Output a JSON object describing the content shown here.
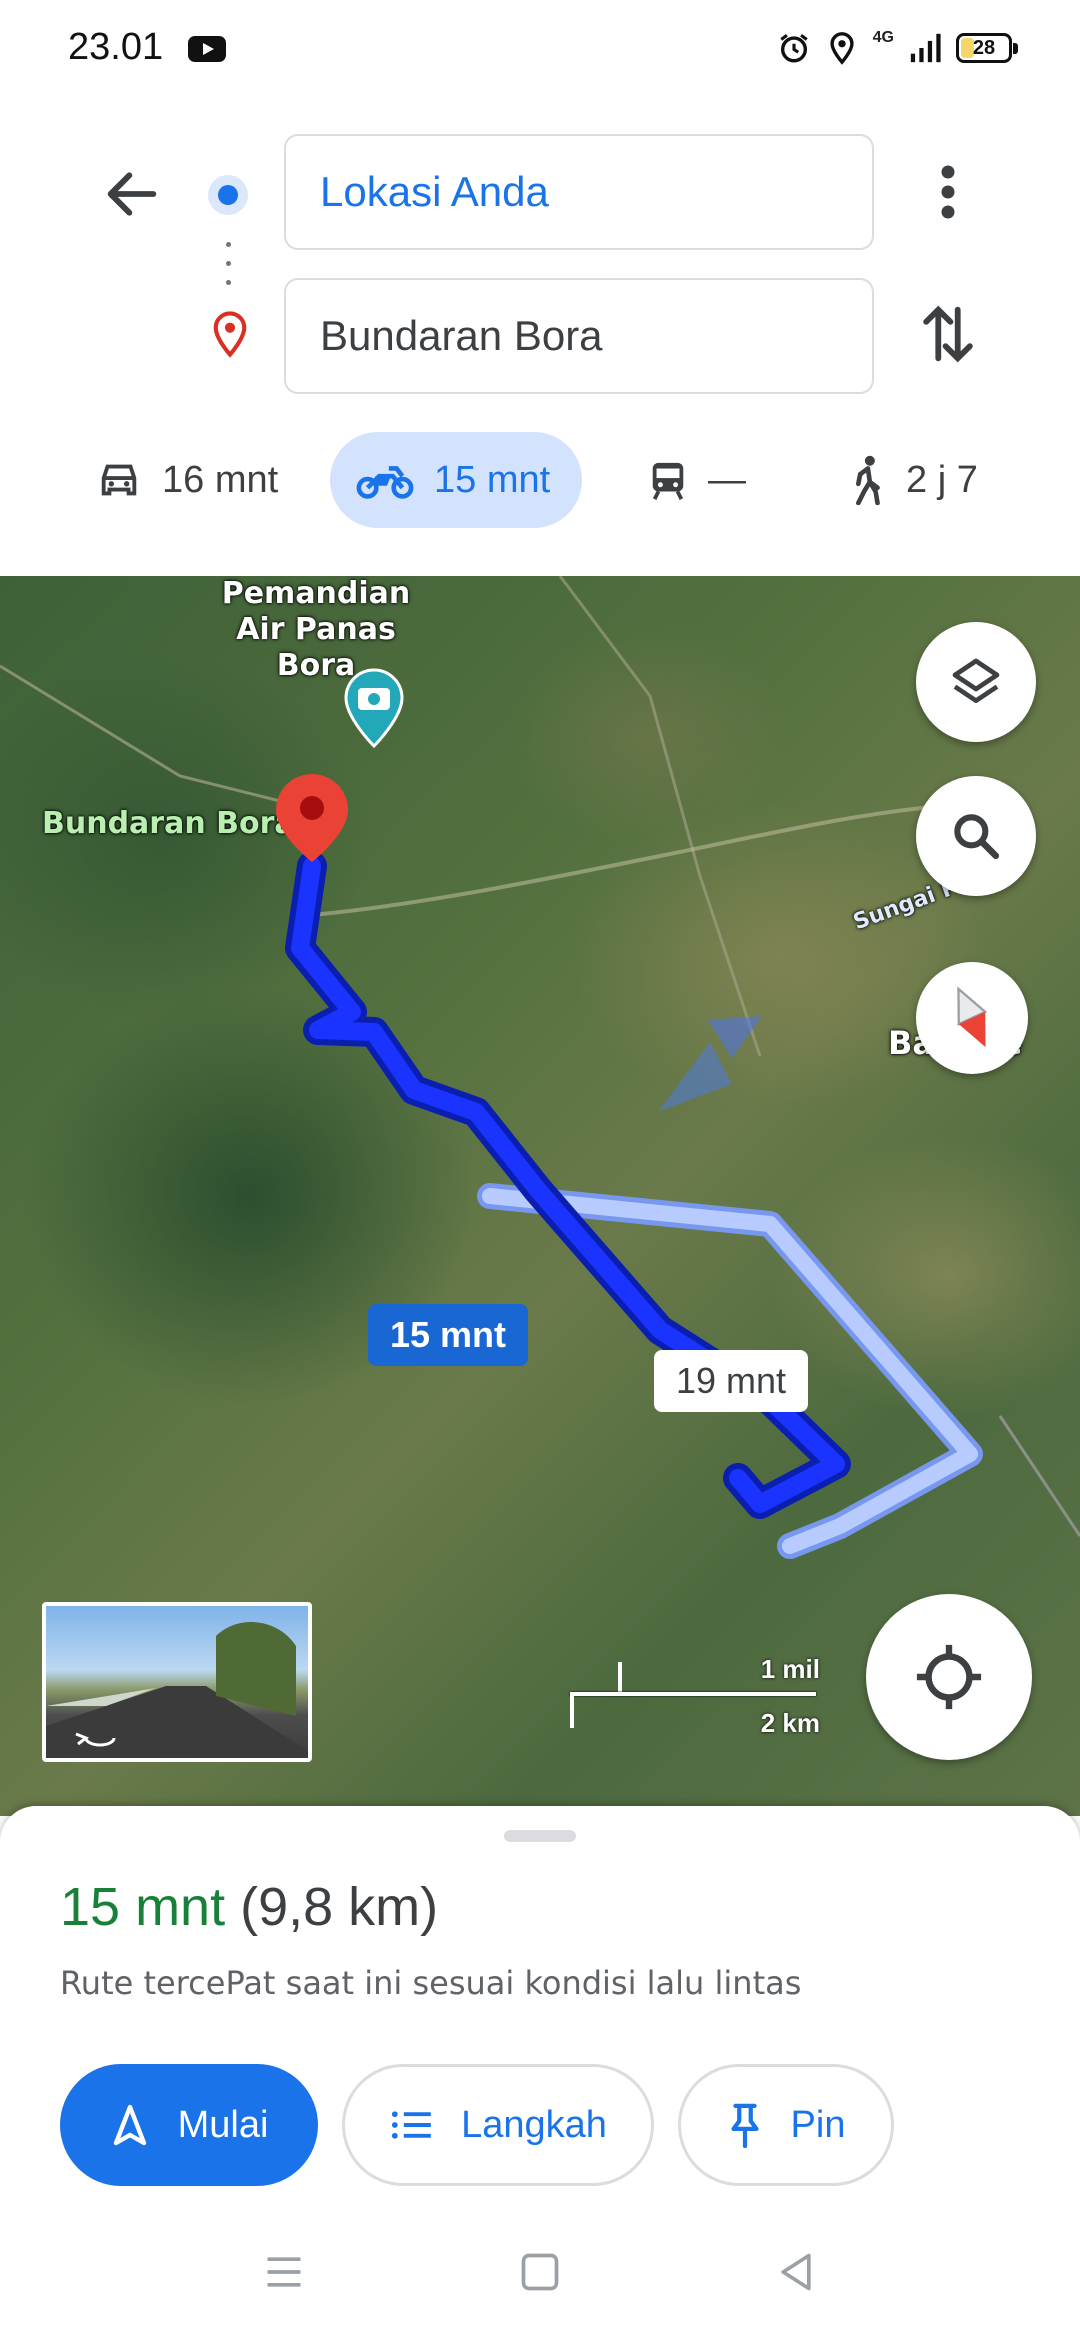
{
  "status_bar": {
    "time": "23.01",
    "network": "4G",
    "battery": "28",
    "battery_level": 0.28
  },
  "directions": {
    "origin": "Lokasi Anda",
    "destination": "Bundaran Bora",
    "icons": [
      "back-arrow-icon",
      "more-vert-icon",
      "swap-icon"
    ]
  },
  "modes": [
    {
      "name": "car",
      "icon": "car-icon",
      "label": "16 mnt",
      "selected": false
    },
    {
      "name": "motorcycle",
      "icon": "motorcycle-icon",
      "label": "15 mnt",
      "selected": true
    },
    {
      "name": "transit",
      "icon": "transit-icon",
      "label": "—",
      "selected": false
    },
    {
      "name": "walk",
      "icon": "walk-icon",
      "label": "2 j 7",
      "selected": false
    }
  ],
  "map": {
    "poi_label": "Pemandian Air Panas Bora",
    "destination_label": "Bundaran Bora",
    "river_label": "Sungai Palu",
    "village_label": "Ba    adje",
    "route_fast_time": "15 mnt",
    "route_alt_time": "19 mnt",
    "scale_miles": "1 mil",
    "scale_km": "2 km",
    "route_color": "#1a33ff",
    "alt_route_color": "#a8c0ff"
  },
  "sheet": {
    "time": "15 mnt",
    "distance": "(9,8 km)",
    "description": "Rute tercePat saat ini sesuai kondisi lalu lintas",
    "start_label": "Mulai",
    "steps_label": "Langkah",
    "pin_label": "Pin",
    "accent": "#1a73e8",
    "time_color": "#188038"
  }
}
